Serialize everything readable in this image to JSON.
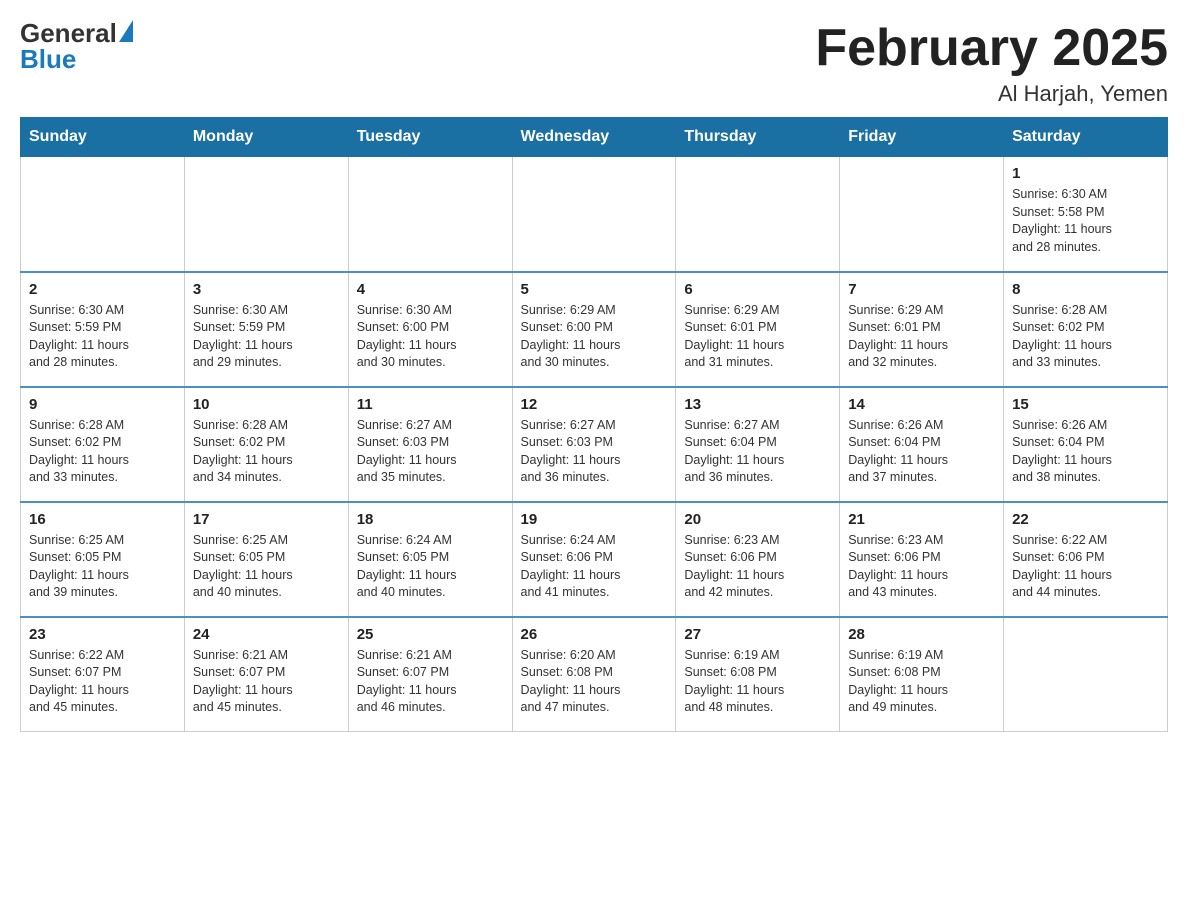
{
  "logo": {
    "general": "General",
    "blue": "Blue"
  },
  "title": "February 2025",
  "subtitle": "Al Harjah, Yemen",
  "weekdays": [
    "Sunday",
    "Monday",
    "Tuesday",
    "Wednesday",
    "Thursday",
    "Friday",
    "Saturday"
  ],
  "weeks": [
    [
      {
        "day": "",
        "info": ""
      },
      {
        "day": "",
        "info": ""
      },
      {
        "day": "",
        "info": ""
      },
      {
        "day": "",
        "info": ""
      },
      {
        "day": "",
        "info": ""
      },
      {
        "day": "",
        "info": ""
      },
      {
        "day": "1",
        "info": "Sunrise: 6:30 AM\nSunset: 5:58 PM\nDaylight: 11 hours\nand 28 minutes."
      }
    ],
    [
      {
        "day": "2",
        "info": "Sunrise: 6:30 AM\nSunset: 5:59 PM\nDaylight: 11 hours\nand 28 minutes."
      },
      {
        "day": "3",
        "info": "Sunrise: 6:30 AM\nSunset: 5:59 PM\nDaylight: 11 hours\nand 29 minutes."
      },
      {
        "day": "4",
        "info": "Sunrise: 6:30 AM\nSunset: 6:00 PM\nDaylight: 11 hours\nand 30 minutes."
      },
      {
        "day": "5",
        "info": "Sunrise: 6:29 AM\nSunset: 6:00 PM\nDaylight: 11 hours\nand 30 minutes."
      },
      {
        "day": "6",
        "info": "Sunrise: 6:29 AM\nSunset: 6:01 PM\nDaylight: 11 hours\nand 31 minutes."
      },
      {
        "day": "7",
        "info": "Sunrise: 6:29 AM\nSunset: 6:01 PM\nDaylight: 11 hours\nand 32 minutes."
      },
      {
        "day": "8",
        "info": "Sunrise: 6:28 AM\nSunset: 6:02 PM\nDaylight: 11 hours\nand 33 minutes."
      }
    ],
    [
      {
        "day": "9",
        "info": "Sunrise: 6:28 AM\nSunset: 6:02 PM\nDaylight: 11 hours\nand 33 minutes."
      },
      {
        "day": "10",
        "info": "Sunrise: 6:28 AM\nSunset: 6:02 PM\nDaylight: 11 hours\nand 34 minutes."
      },
      {
        "day": "11",
        "info": "Sunrise: 6:27 AM\nSunset: 6:03 PM\nDaylight: 11 hours\nand 35 minutes."
      },
      {
        "day": "12",
        "info": "Sunrise: 6:27 AM\nSunset: 6:03 PM\nDaylight: 11 hours\nand 36 minutes."
      },
      {
        "day": "13",
        "info": "Sunrise: 6:27 AM\nSunset: 6:04 PM\nDaylight: 11 hours\nand 36 minutes."
      },
      {
        "day": "14",
        "info": "Sunrise: 6:26 AM\nSunset: 6:04 PM\nDaylight: 11 hours\nand 37 minutes."
      },
      {
        "day": "15",
        "info": "Sunrise: 6:26 AM\nSunset: 6:04 PM\nDaylight: 11 hours\nand 38 minutes."
      }
    ],
    [
      {
        "day": "16",
        "info": "Sunrise: 6:25 AM\nSunset: 6:05 PM\nDaylight: 11 hours\nand 39 minutes."
      },
      {
        "day": "17",
        "info": "Sunrise: 6:25 AM\nSunset: 6:05 PM\nDaylight: 11 hours\nand 40 minutes."
      },
      {
        "day": "18",
        "info": "Sunrise: 6:24 AM\nSunset: 6:05 PM\nDaylight: 11 hours\nand 40 minutes."
      },
      {
        "day": "19",
        "info": "Sunrise: 6:24 AM\nSunset: 6:06 PM\nDaylight: 11 hours\nand 41 minutes."
      },
      {
        "day": "20",
        "info": "Sunrise: 6:23 AM\nSunset: 6:06 PM\nDaylight: 11 hours\nand 42 minutes."
      },
      {
        "day": "21",
        "info": "Sunrise: 6:23 AM\nSunset: 6:06 PM\nDaylight: 11 hours\nand 43 minutes."
      },
      {
        "day": "22",
        "info": "Sunrise: 6:22 AM\nSunset: 6:06 PM\nDaylight: 11 hours\nand 44 minutes."
      }
    ],
    [
      {
        "day": "23",
        "info": "Sunrise: 6:22 AM\nSunset: 6:07 PM\nDaylight: 11 hours\nand 45 minutes."
      },
      {
        "day": "24",
        "info": "Sunrise: 6:21 AM\nSunset: 6:07 PM\nDaylight: 11 hours\nand 45 minutes."
      },
      {
        "day": "25",
        "info": "Sunrise: 6:21 AM\nSunset: 6:07 PM\nDaylight: 11 hours\nand 46 minutes."
      },
      {
        "day": "26",
        "info": "Sunrise: 6:20 AM\nSunset: 6:08 PM\nDaylight: 11 hours\nand 47 minutes."
      },
      {
        "day": "27",
        "info": "Sunrise: 6:19 AM\nSunset: 6:08 PM\nDaylight: 11 hours\nand 48 minutes."
      },
      {
        "day": "28",
        "info": "Sunrise: 6:19 AM\nSunset: 6:08 PM\nDaylight: 11 hours\nand 49 minutes."
      },
      {
        "day": "",
        "info": ""
      }
    ]
  ]
}
